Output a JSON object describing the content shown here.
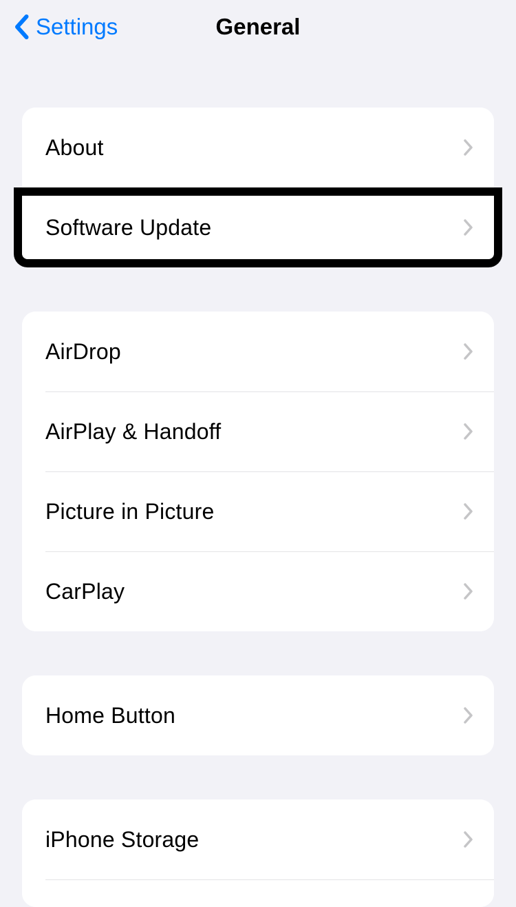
{
  "nav": {
    "back_label": "Settings",
    "title": "General"
  },
  "sections": [
    {
      "rows": [
        {
          "label": "About"
        },
        {
          "label": "Software Update",
          "highlighted": true
        }
      ]
    },
    {
      "rows": [
        {
          "label": "AirDrop"
        },
        {
          "label": "AirPlay & Handoff"
        },
        {
          "label": "Picture in Picture"
        },
        {
          "label": "CarPlay"
        }
      ]
    },
    {
      "rows": [
        {
          "label": "Home Button"
        }
      ]
    },
    {
      "rows": [
        {
          "label": "iPhone Storage"
        }
      ]
    }
  ]
}
